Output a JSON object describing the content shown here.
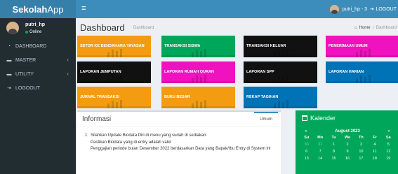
{
  "brand": {
    "strong": "Sekolah",
    "light": "App"
  },
  "topbar": {
    "menu_icon": "hamburger-icon",
    "user_label": "putri_hp - 3",
    "logout_label": "LOGOUT"
  },
  "sidebar": {
    "user": {
      "name": "putri_hp",
      "status": "Online"
    },
    "items": [
      {
        "label": "DASHBOARD",
        "icon": "dashboard-icon"
      },
      {
        "label": "MASTER",
        "icon": "folder-icon"
      },
      {
        "label": "UTILITY",
        "icon": "folder-icon"
      },
      {
        "label": "LOGOOUT",
        "icon": "sign-out-icon"
      }
    ]
  },
  "page": {
    "title": "Dashboard",
    "subtitle": "Dashboard",
    "breadcrumb": {
      "home": "Home",
      "current": "Dashboard"
    }
  },
  "tiles": [
    {
      "label": "SETOR KE BENDAHARA YAYASAN",
      "color": "#f39c12"
    },
    {
      "label": "TRANSAKSI SISWA",
      "color": "#00a65a"
    },
    {
      "label": "TRANSAKSI KELUAR",
      "color": "#111111"
    },
    {
      "label": "PENERIMAAN UMUM",
      "color": "#f012be"
    },
    {
      "label": "LAPORAN JEMPUTAN",
      "color": "#111111"
    },
    {
      "label": "LAPORAN RUMAH QURAN",
      "color": "#f012be"
    },
    {
      "label": "LAPORAN SPP",
      "color": "#111111"
    },
    {
      "label": "LAPORAN HARIAN",
      "color": "#0073b7"
    },
    {
      "label": "JURNAL TRANSAKSI",
      "color": "#f39c12"
    },
    {
      "label": "BUKU BESAR",
      "color": "#f39c12"
    },
    {
      "label": "REKAP TAGIHAN",
      "color": "#0073b7"
    }
  ],
  "info": {
    "title": "Informasi",
    "tab": "Umum",
    "item_number": "1",
    "lines": [
      "Silahkan Update Biodata Diri di menu yang sudah di sediakan",
      "Pastikan Biodata yang di entry adalah valid",
      "Penggajian periode bulan Desember 2022 berdasarkan Data yang Bapak/Ibu Entry di System ini"
    ]
  },
  "calendar": {
    "title": "Kalender",
    "prev": "«",
    "month": "August 2023",
    "next": "»",
    "day_names": [
      "Su",
      "Mo",
      "Tu",
      "We",
      "Th",
      "Fr",
      "Sa"
    ],
    "rows": [
      [
        "30",
        "31",
        "1",
        "2",
        "3",
        "4",
        "5"
      ],
      [
        "6",
        "7",
        "8",
        "9",
        "10",
        "11",
        "12"
      ],
      [
        "13",
        "14",
        "15",
        "16",
        "17",
        "18",
        "19"
      ]
    ]
  }
}
